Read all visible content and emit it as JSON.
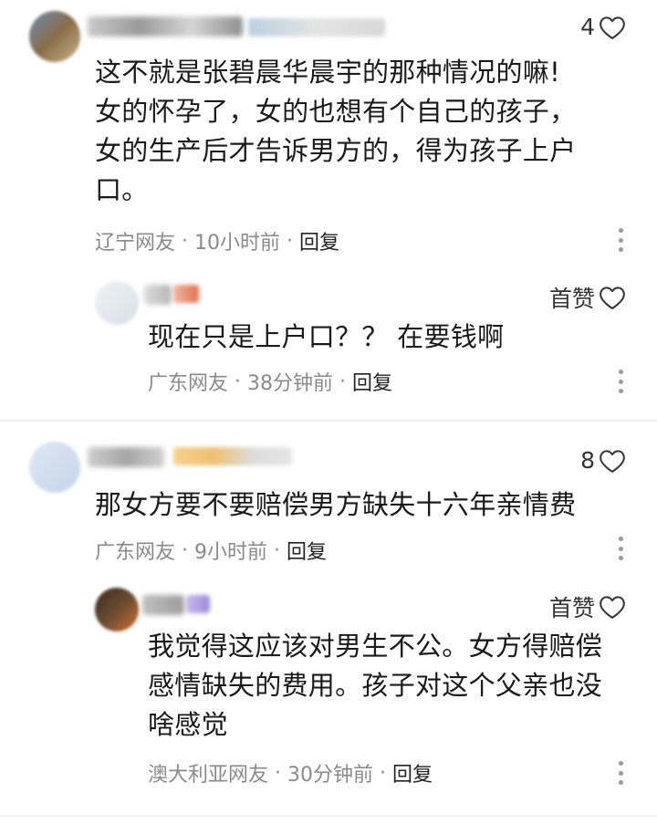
{
  "comments": [
    {
      "likes": "4",
      "text_lines": [
        "这不就是张碧晨华晨宇的那种情况的嘛!",
        "女的怀孕了，女的也想有个自己的孩子，",
        "女的生产后才告诉男方的，得为孩子上户",
        "口。"
      ],
      "location": "辽宁网友",
      "time": "10小时前",
      "reply_label": "回复",
      "reply": {
        "likes": "首赞",
        "text_lines": [
          "现在只是上户口？？ 在要钱啊"
        ],
        "location": "广东网友",
        "time": "38分钟前",
        "reply_label": "回复"
      }
    },
    {
      "likes": "8",
      "text_lines": [
        "那女方要不要赔偿男方缺失十六年亲情费"
      ],
      "location": "广东网友",
      "time": "9小时前",
      "reply_label": "回复",
      "reply": {
        "likes": "首赞",
        "text_lines": [
          "我觉得这应该对男生不公。女方得赔偿",
          "感情缺失的费用。孩子对这个父亲也没",
          "啥感觉"
        ],
        "location": "澳大利亚网友",
        "time": "30分钟前",
        "reply_label": "回复"
      }
    }
  ],
  "icons": {
    "like": "heart-outline-icon",
    "more": "more-vertical-icon"
  }
}
